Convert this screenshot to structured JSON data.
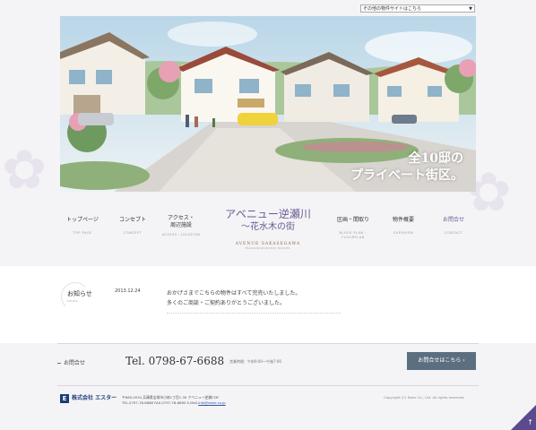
{
  "top": {
    "site_selector": "その他の物件サイトはこちら"
  },
  "hero": {
    "copy_line1": "全10邸の",
    "copy_line2": "プライベート街区。"
  },
  "nav": {
    "items": [
      {
        "jp": "トップページ",
        "en": "TOP PAGE"
      },
      {
        "jp": "コンセプト",
        "en": "CONCEPT"
      },
      {
        "jp": "アクセス・\n周辺施設",
        "en": "ACCESS・LOCATION"
      },
      {
        "jp": "区画・間取り",
        "en": "BLOCK PLAN・FLOORPLAN"
      },
      {
        "jp": "物件概要",
        "en": "OVERVIEW"
      },
      {
        "jp": "お問合せ",
        "en": "CONTACT"
      }
    ],
    "logo": {
      "line1": "アベニュー逆瀬川",
      "line2": "〜花水木の街",
      "en": "AVENUE SAKASEGAWA",
      "en_sub": "HANAMIZUKINO MACHI"
    }
  },
  "news": {
    "heading": "お知らせ",
    "heading_en": "NEWS",
    "date": "2013.12.24",
    "line1": "おかげさまでこちらの物件はすべて完売いたしました。",
    "line2": "多くのご商談・ご契約ありがとうございました。"
  },
  "contact": {
    "label": "お問合せ",
    "tel": "Tel. 0798-67-6688",
    "hours": "営業時間：午前9:00〜午後7:00",
    "button": "お問合せはこちら"
  },
  "footer": {
    "brand": "株式会社 エスター",
    "brand_mark": "E",
    "address": "〒665-0034 兵庫県宝塚市小林1丁目1-39 アベニュー逆瀬川3F",
    "contact_line": "TEL.0797-78-6688 FAX.0797-78-6665 E-Mail.",
    "email": "info@ester.co.jp",
    "copyright": "Copyright (C) Ester Co., Ltd. All rights reserved."
  },
  "colors": {
    "accent": "#6a5a92",
    "button": "#5b6f80",
    "brand": "#1b3c7a"
  }
}
